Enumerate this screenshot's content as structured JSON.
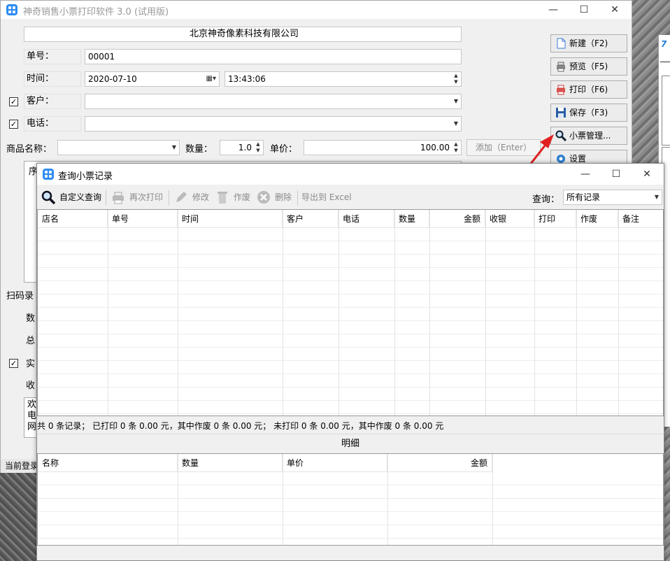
{
  "main_window": {
    "title": "神奇销售小票打印软件 3.0 (试用版)",
    "company": "北京神奇像素科技有限公司",
    "order_no_label": "单号：",
    "order_no": "00001",
    "time_label": "时间：",
    "date": "2020-07-10",
    "time": "13:43:06",
    "customer_label": "客户：",
    "customer_value": "",
    "phone_label": "电话：",
    "phone_value": "",
    "product_label": "商品名称：",
    "quantity_label": "数量：",
    "quantity": "1.0",
    "price_label": "单价：",
    "price": "100.00",
    "add_button": "添加（Enter）",
    "items_grid_col1": "序",
    "scan_label": "扫码录",
    "side_labels": [
      "数",
      "总",
      "实",
      "收"
    ],
    "notes_text": [
      "欢",
      "电",
      "网"
    ],
    "status_text": "当前登录"
  },
  "right_buttons": [
    {
      "label": "新建（F2)",
      "icon": "new-document-icon"
    },
    {
      "label": "预览（F5)",
      "icon": "preview-printer-icon"
    },
    {
      "label": "打印（F6)",
      "icon": "printer-icon"
    },
    {
      "label": "保存（F3)",
      "icon": "floppy-save-icon"
    },
    {
      "label": "小票管理...",
      "icon": "magnifier-icon"
    },
    {
      "label": "设置",
      "icon": "gear-icon"
    }
  ],
  "dialog": {
    "title": "查询小票记录",
    "toolbar": {
      "custom_query": "自定义查询",
      "reprint": "再次打印",
      "edit": "修改",
      "void": "作废",
      "delete": "删除",
      "export": "导出到 Excel"
    },
    "query_label": "查询：",
    "query_value": "所有记录",
    "columns": [
      "店名",
      "单号",
      "时间",
      "客户",
      "电话",
      "数量",
      "金额",
      "收银",
      "打印",
      "作废",
      "备注"
    ],
    "summary": "共 0 条记录；  已打印 0 条 0.00 元，其中作废 0 条 0.00 元；  未打印 0 条 0.00 元，其中作废 0 条 0.00 元",
    "detail_title": "明细",
    "detail_columns": [
      "名称",
      "数量",
      "单价",
      "金额"
    ]
  },
  "colors": {
    "accent": "#2d8cf0",
    "arrow": "#e02020"
  }
}
